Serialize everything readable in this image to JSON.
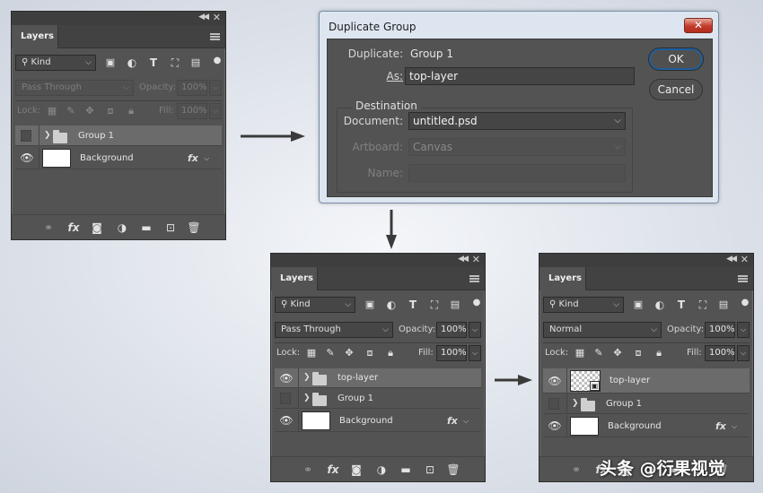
{
  "panel_tab": "Layers",
  "filter_kind": "Kind",
  "lock_label": "Lock:",
  "opacity_label": "Opacity:",
  "fill_label": "Fill:",
  "panel1": {
    "blend_mode": "Pass Through",
    "opacity": "100%",
    "fill": "100%",
    "layers": [
      "Group 1",
      "Background"
    ]
  },
  "dialog": {
    "title": "Duplicate Group",
    "close_glyph": "✕",
    "duplicate_label": "Duplicate:",
    "duplicate_value": "Group 1",
    "as_label": "As:",
    "as_value": "top-layer",
    "destination_legend": "Destination",
    "document_label": "Document:",
    "document_value": "untitled.psd",
    "artboard_label": "Artboard:",
    "artboard_value": "Canvas",
    "name_label": "Name:",
    "name_value": "",
    "ok_label": "OK",
    "cancel_label": "Cancel"
  },
  "panel2": {
    "blend_mode": "Pass Through",
    "opacity": "100%",
    "fill": "100%",
    "layers": [
      "top-layer",
      "Group 1",
      "Background"
    ]
  },
  "panel3": {
    "blend_mode": "Normal",
    "opacity": "100%",
    "fill": "100%",
    "layers": [
      "top-layer",
      "Group 1",
      "Background"
    ]
  },
  "watermark": "头条 @衍果视觉",
  "colors": {
    "panel_bg": "#535353",
    "selected_row": "#6b6b6b",
    "dialog_frame": "#dde6f0",
    "ok_focus": "#1f5f9e",
    "close_red": "#c23b2a"
  }
}
